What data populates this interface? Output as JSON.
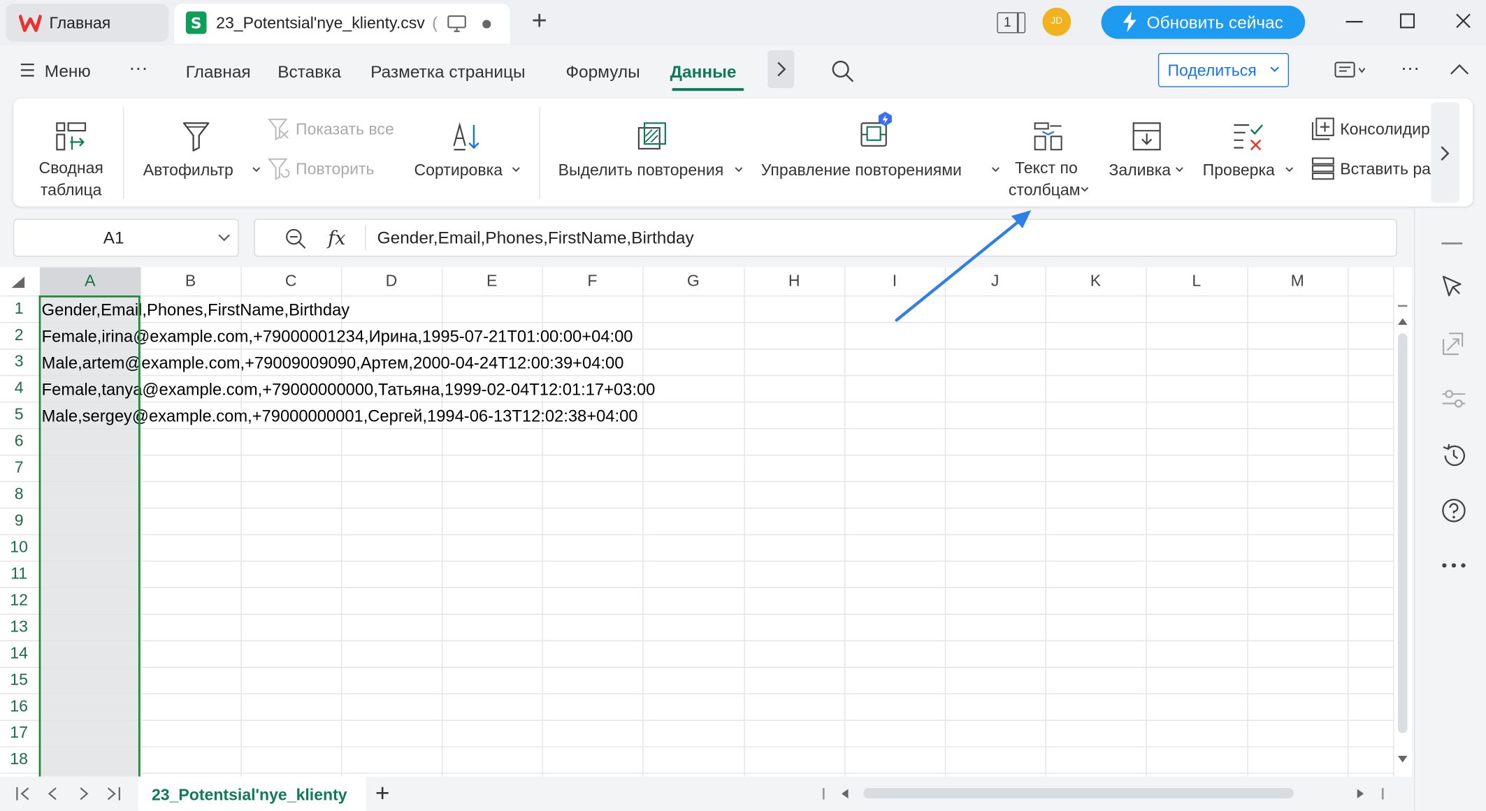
{
  "tabs": {
    "home_label": "Главная",
    "file_label": "23_Potentsial'nye_klienty.csv",
    "file_suffix": "(",
    "add_tab": "+"
  },
  "titlebar": {
    "page_count": "1",
    "avatar_initials": "JD",
    "update_button": "Обновить сейчас"
  },
  "menu": {
    "menu_label": "Меню",
    "more": "···",
    "items": [
      "Главная",
      "Вставка",
      "Разметка страницы",
      "Формулы",
      "Данные"
    ],
    "active_index": 4,
    "share_label": "Поделиться"
  },
  "ribbon": {
    "pivot_line1": "Сводная",
    "pivot_line2": "таблица",
    "autofilter": "Автофильтр",
    "show_all": "Показать все",
    "reapply": "Повторить",
    "sort": "Сортировка",
    "highlight_dupes": "Выделить повторения",
    "manage_dupes": "Управление повторениями",
    "text_to_cols_line1": "Текст по",
    "text_to_cols_line2": "столбцам",
    "fill": "Заливка",
    "validation": "Проверка",
    "consolidate": "Консолидир",
    "insert_rows": "Вставить ра"
  },
  "formula_bar": {
    "cell_ref": "A1",
    "fx": "fx",
    "content": "Gender,Email,Phones,FirstName,Birthday"
  },
  "grid": {
    "columns": [
      "A",
      "B",
      "C",
      "D",
      "E",
      "F",
      "G",
      "H",
      "I",
      "J",
      "K",
      "L",
      "M"
    ],
    "rows": [
      "1",
      "2",
      "3",
      "4",
      "5",
      "6",
      "7",
      "8",
      "9",
      "10",
      "11",
      "12",
      "13",
      "14",
      "15",
      "16",
      "17",
      "18"
    ],
    "cells": [
      "Gender,Email,Phones,FirstName,Birthday",
      "Female,irina@example.com,+79000001234,Ирина,1995-07-21T01:00:00+04:00",
      "Male,artem@example.com,+79009009090,Артем,2000-04-24T12:00:39+04:00",
      "Female,tanya@example.com,+79000000000,Татьяна,1999-02-04T12:01:17+03:00",
      "Male,sergey@example.com,+79000000001,Сергей,1994-06-13T12:02:38+04:00"
    ]
  },
  "sheets": {
    "active": "23_Potentsial'nye_klienty",
    "add": "+"
  },
  "colors": {
    "accent_green": "#0f7b54",
    "update_button": "#1e9bf0",
    "share_blue": "#1a73e8",
    "annotation_arrow": "#2f7fe6",
    "selection": "#1f8a3c"
  }
}
